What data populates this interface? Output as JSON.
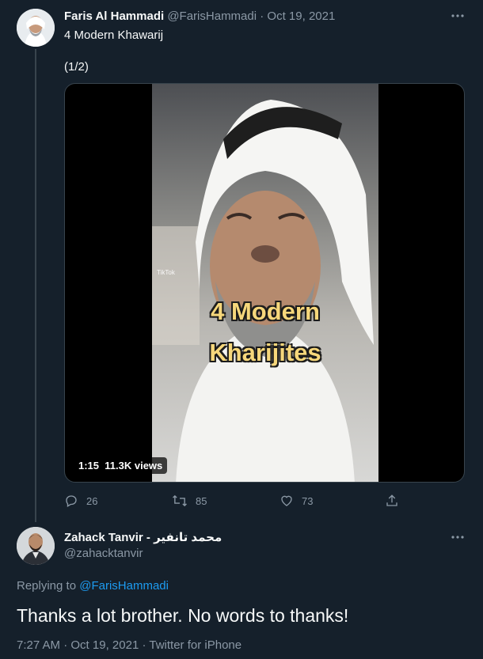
{
  "tweet1": {
    "name": "Faris Al Hammadi",
    "handle": "@FarisHammadi",
    "separator": "·",
    "date": "Oct 19, 2021",
    "text": "4 Modern Khawarij",
    "part": "(1/2)",
    "video": {
      "overlay_line1": "4 Modern",
      "overlay_line2": "Kharijites",
      "watermark": "TikTok",
      "duration": "1:15",
      "views": "11.3K views"
    },
    "actions": {
      "replies": "26",
      "retweets": "85",
      "likes": "73"
    }
  },
  "tweet2": {
    "name": "Zahack Tanvir - محمد تانفير",
    "handle": "@zahacktanvir",
    "replying_prefix": "Replying to",
    "replying_to": "@FarisHammadi",
    "text": "Thanks a lot brother. No words to thanks!",
    "time": "7:27 AM",
    "separator": "·",
    "date": "Oct 19, 2021",
    "separator2": "·",
    "source": "Twitter for iPhone"
  },
  "icons": {
    "more": "more-horizontal-icon",
    "reply": "reply-icon",
    "retweet": "retweet-icon",
    "like": "heart-icon",
    "share": "share-icon"
  },
  "colors": {
    "background": "#15202b",
    "text": "#f7f9f9",
    "muted": "#8b98a5",
    "accent": "#1d9bf0",
    "overlay_text": "#f6d77b"
  }
}
